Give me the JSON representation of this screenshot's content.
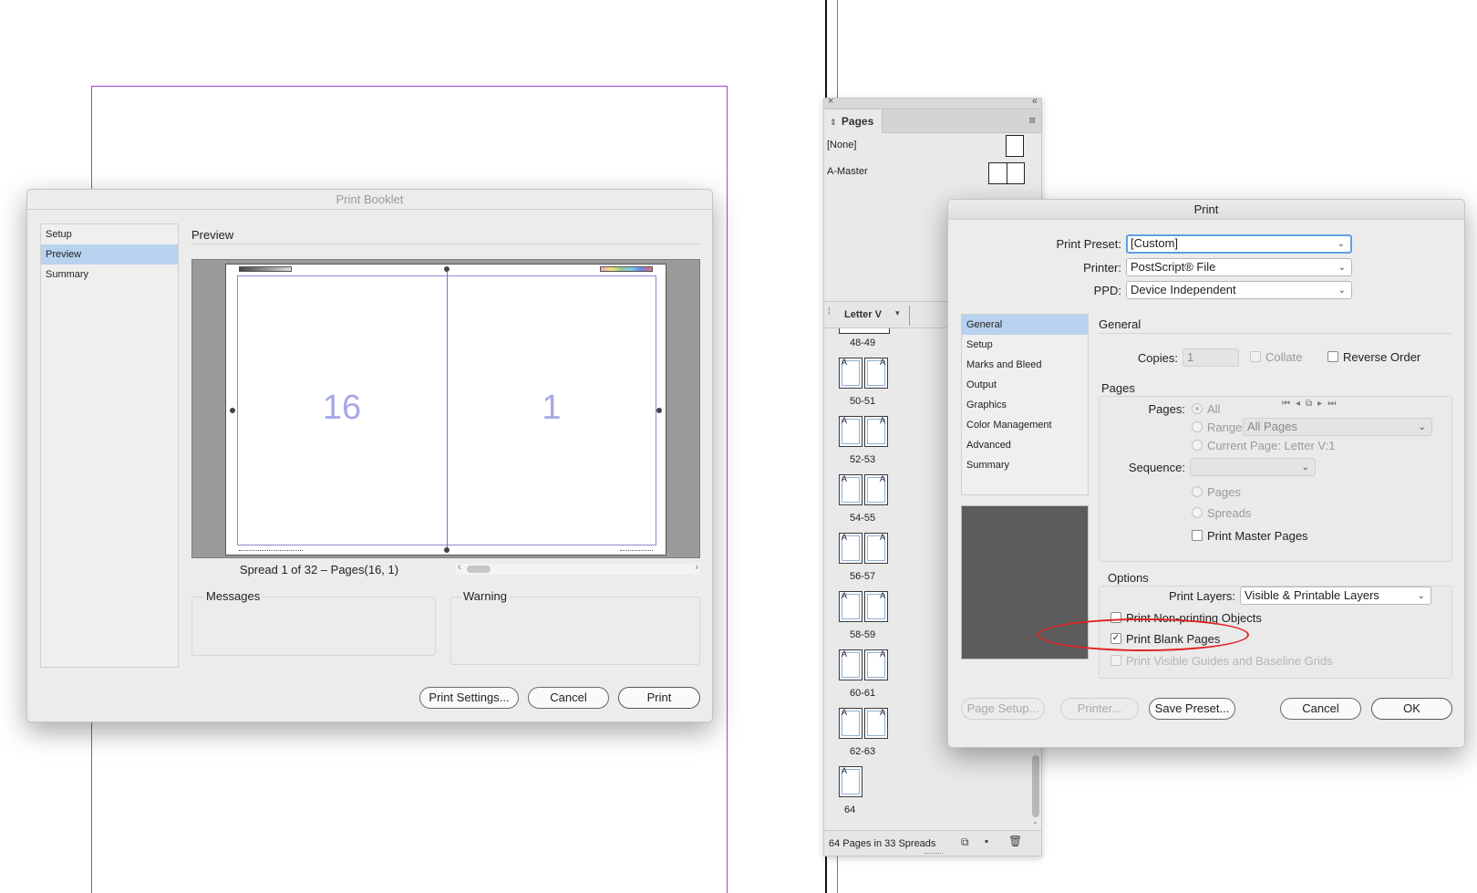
{
  "booklet": {
    "title": "Print Booklet",
    "nav": [
      "Setup",
      "Preview",
      "Summary"
    ],
    "selected_nav": "Preview",
    "section": "Preview",
    "left_page_number": "16",
    "right_page_number": "1",
    "spread_caption": "Spread 1 of 32 – Pages(16, 1)",
    "messages_label": "Messages",
    "warning_label": "Warning",
    "buttons": {
      "print_settings": "Print Settings...",
      "cancel": "Cancel",
      "print": "Print"
    }
  },
  "pages_panel": {
    "title": "Pages",
    "masters": [
      "[None]",
      "A-Master"
    ],
    "section_label": "Letter V",
    "spreads": [
      "48-49",
      "50-51",
      "52-53",
      "54-55",
      "56-57",
      "58-59",
      "60-61",
      "62-63",
      "64"
    ],
    "master_prefix": "A",
    "status": "64 Pages in 33 Spreads"
  },
  "print": {
    "title": "Print",
    "preset_label": "Print Preset:",
    "preset_value": "[Custom]",
    "printer_label": "Printer:",
    "printer_value": "PostScript® File",
    "ppd_label": "PPD:",
    "ppd_value": "Device Independent",
    "nav": [
      "General",
      "Setup",
      "Marks and Bleed",
      "Output",
      "Graphics",
      "Color Management",
      "Advanced",
      "Summary"
    ],
    "selected_nav": "General",
    "section": "General",
    "copies_label": "Copies:",
    "copies_value": "1",
    "collate_label": "Collate",
    "reverse_order_label": "Reverse Order",
    "pages_group": "Pages",
    "pages_label": "Pages:",
    "all_label": "All",
    "range_label": "Range:",
    "range_value": "All Pages",
    "current_page_label": "Current Page: Letter V:1",
    "sequence_label": "Sequence:",
    "pages_option": "Pages",
    "spreads_option": "Spreads",
    "print_master_pages_label": "Print Master Pages",
    "options_group": "Options",
    "print_layers_label": "Print Layers:",
    "print_layers_value": "Visible & Printable Layers",
    "non_printing_label": "Print Non-printing Objects",
    "blank_pages_label": "Print Blank Pages",
    "blank_pages_checked": true,
    "guides_label": "Print Visible Guides and Baseline Grids",
    "buttons": {
      "page_setup": "Page Setup...",
      "printer": "Printer...",
      "save_preset": "Save Preset...",
      "cancel": "Cancel",
      "ok": "OK"
    }
  },
  "colors": {
    "highlight_ellipse": "#e02020",
    "page_number": "#a7a9e8",
    "selection": "#b8d2ef"
  }
}
